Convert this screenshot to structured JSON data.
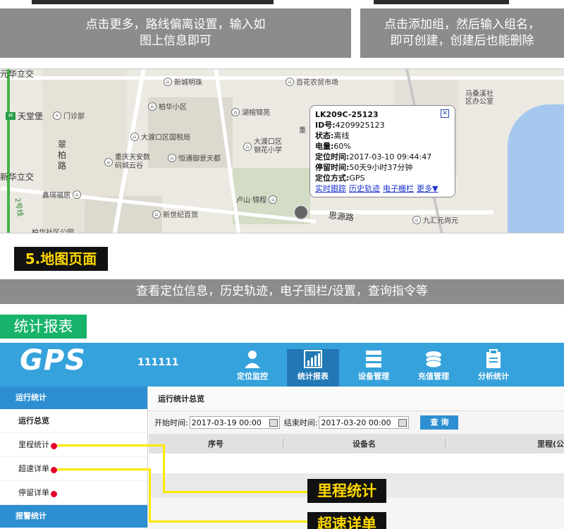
{
  "top_panels": {
    "left_text": "点击更多，路线偏离设置，输入如\n图上信息即可",
    "right_text": "点击添加组，然后输入组名，\n即可创建，创建后也能删除"
  },
  "map": {
    "pois": [
      "新城明珠",
      "百花农贸市场",
      "柏华小区",
      "湖榕锦苑",
      "马桑溪社\n区办公室",
      "大渡口区国税局",
      "大渡口区\n钢花小学",
      "重庆天安数\n码城云谷",
      "恒通御景天都",
      "鑫瑞福居",
      "卢山·锦程",
      "新世纪百货",
      "九汇元尚元",
      "门诊部",
      "天堂堡",
      "翠\n柏\n路",
      "新华立交",
      "柏华社区公园",
      "思源路",
      "元华立交",
      "2号线",
      "重"
    ],
    "popup": {
      "device": "LK209C-25123",
      "id_label": "ID号:",
      "id_value": "4209925123",
      "status_label": "状态:",
      "status_value": "离线",
      "battery_label": "电量:",
      "battery_value": "60%",
      "time_label": "定位时间:",
      "time_value": "2017-03-10 09:44:47",
      "stay_label": "停留时间:",
      "stay_value": "50天9小时37分钟",
      "mode_label": "定位方式:",
      "mode_value": "GPS",
      "links": [
        "实时跟踪",
        "历史轨迹",
        "电子栅栏",
        "更多▼"
      ]
    }
  },
  "section5": {
    "heading": "5.地图页面",
    "desc": "查看定位信息，历史轨迹，电子围栏/设置，查询指令等"
  },
  "stats_heading": "统计报表",
  "app": {
    "logo": "GPS",
    "user": "111111",
    "nav": [
      "定位监控",
      "统计报表",
      "设备管理",
      "充值管理",
      "分析统计"
    ],
    "sidebar": {
      "head1": "运行统计",
      "items": [
        "运行总览",
        "里程统计",
        "超速详单",
        "停留详单"
      ],
      "head2": "报警统计"
    },
    "main": {
      "title": "运行统计总览",
      "start_label": "开始时间:",
      "start_value": "2017-03-19 00:00",
      "end_label": "结束时间:",
      "end_value": "2017-03-20 00:00",
      "query": "查 询",
      "columns": [
        "序号",
        "设备名",
        "里程(公"
      ]
    },
    "annotations": [
      "里程统计",
      "超速详单"
    ]
  }
}
